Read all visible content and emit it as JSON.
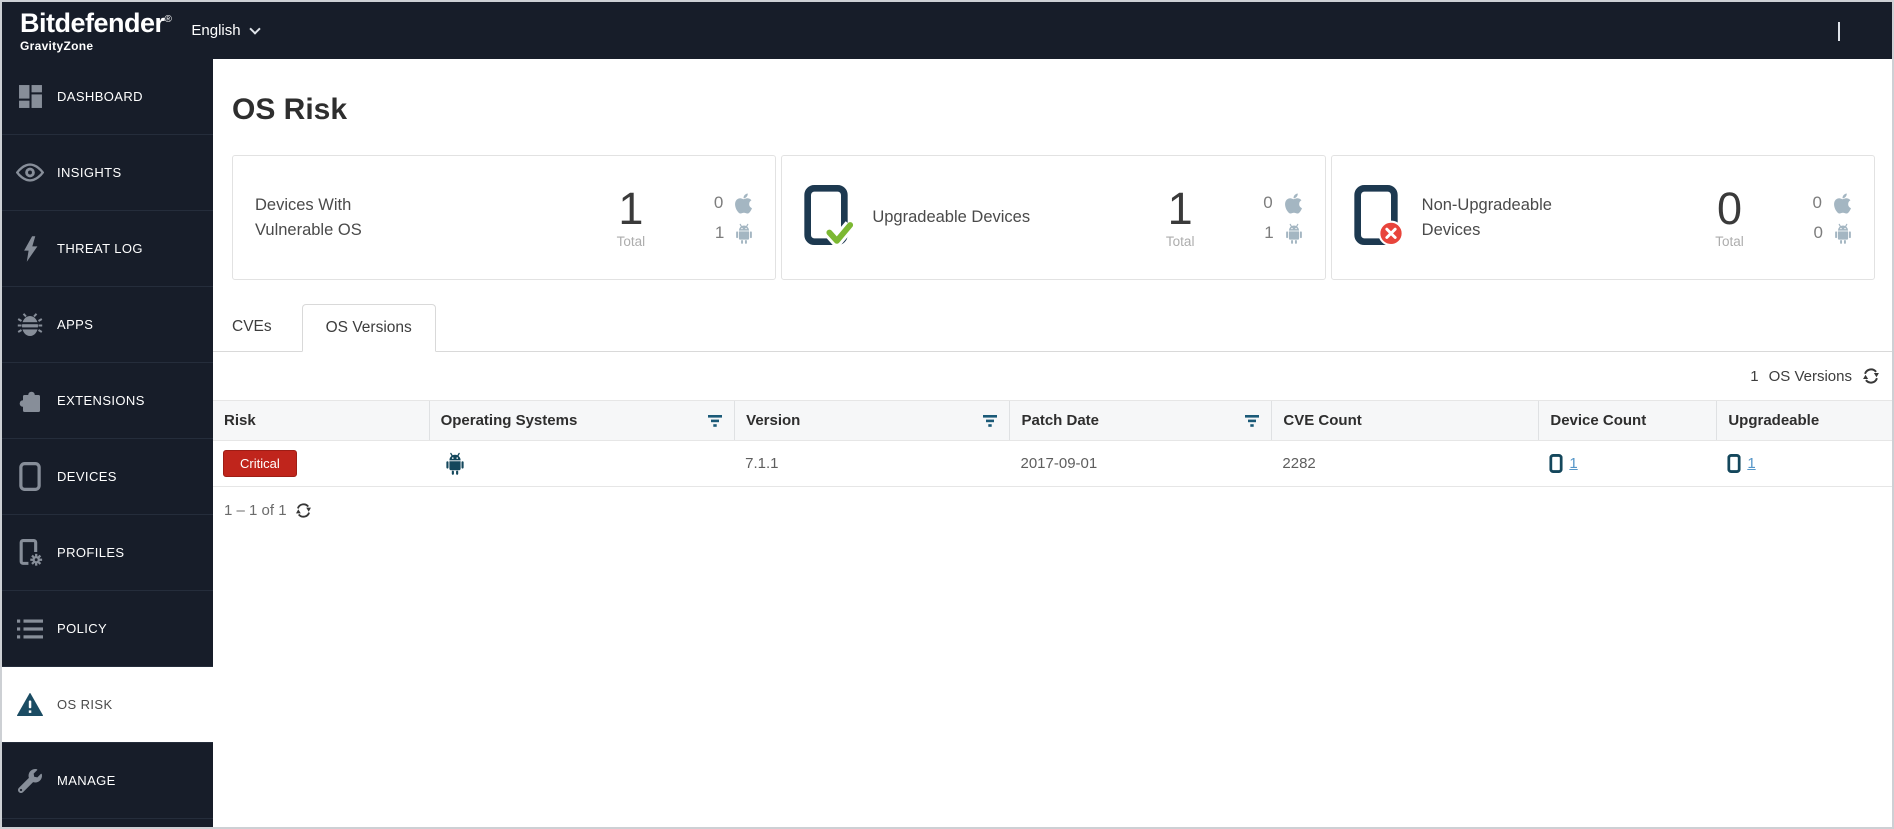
{
  "topbar": {
    "brand": "Bitdefender",
    "brand_reg": "®",
    "brand_sub": "GravityZone",
    "language": "English"
  },
  "sidebar": {
    "items": [
      {
        "label": "DASHBOARD",
        "icon": "dashboard-icon",
        "active": false
      },
      {
        "label": "INSIGHTS",
        "icon": "eye-icon",
        "active": false
      },
      {
        "label": "THREAT LOG",
        "icon": "lightning-icon",
        "active": false
      },
      {
        "label": "APPS",
        "icon": "bug-icon",
        "active": false
      },
      {
        "label": "EXTENSIONS",
        "icon": "puzzle-icon",
        "active": false
      },
      {
        "label": "DEVICES",
        "icon": "device-icon",
        "active": false
      },
      {
        "label": "PROFILES",
        "icon": "device-gear-icon",
        "active": false
      },
      {
        "label": "POLICY",
        "icon": "list-icon",
        "active": false
      },
      {
        "label": "OS RISK",
        "icon": "warning-triangle-icon",
        "active": true
      },
      {
        "label": "MANAGE",
        "icon": "wrench-icon",
        "active": false
      }
    ]
  },
  "page": {
    "title": "OS Risk"
  },
  "cards": [
    {
      "title": "Devices With Vulnerable OS",
      "total": "1",
      "total_label": "Total",
      "apple_count": "0",
      "android_count": "1"
    },
    {
      "title": "Upgradeable Devices",
      "icon": "device-check-icon",
      "total": "1",
      "total_label": "Total",
      "apple_count": "0",
      "android_count": "1"
    },
    {
      "title": "Non-Upgradeable Devices",
      "icon": "device-x-icon",
      "total": "0",
      "total_label": "Total",
      "apple_count": "0",
      "android_count": "0"
    }
  ],
  "tabs": [
    {
      "label": "CVEs",
      "active": false
    },
    {
      "label": "OS Versions",
      "active": true
    }
  ],
  "table": {
    "count": "1",
    "count_label": "OS Versions",
    "columns": [
      {
        "label": "Risk",
        "filter": false
      },
      {
        "label": "Operating Systems",
        "filter": true
      },
      {
        "label": "Version",
        "filter": true
      },
      {
        "label": "Patch Date",
        "filter": true
      },
      {
        "label": "CVE Count",
        "filter": false
      },
      {
        "label": "Device Count",
        "filter": false
      },
      {
        "label": "Upgradeable",
        "filter": false
      }
    ],
    "rows": [
      {
        "risk": "Critical",
        "operating_system": "android",
        "version": "7.1.1",
        "patch_date": "2017-09-01",
        "cve_count": "2282",
        "device_count": "1",
        "upgradeable": "1"
      }
    ],
    "pagination": "1 – 1 of 1"
  },
  "colors": {
    "topbar_bg": "#171d29",
    "accent_teal": "#1b4c63",
    "critical_red": "#c0251c",
    "link_blue": "#5596c8",
    "check_green": "#7cb832",
    "error_red": "#e8443b",
    "platform_icon_gray": "#a4b6c2"
  }
}
